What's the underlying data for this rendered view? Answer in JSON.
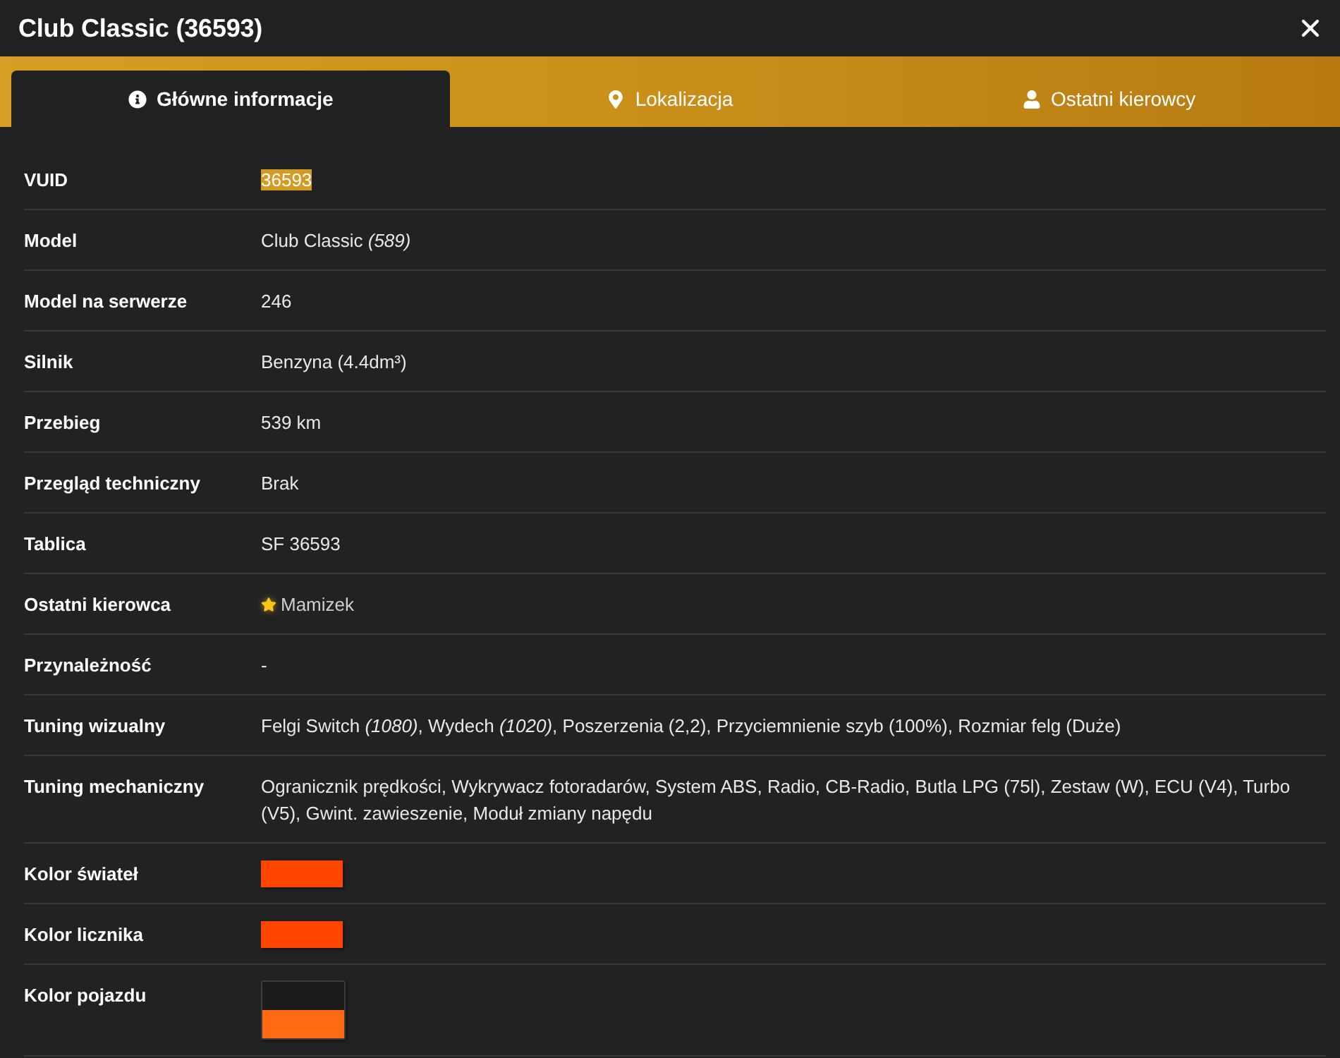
{
  "window": {
    "title": "Club Classic (36593)"
  },
  "tabs": [
    {
      "label": "Główne informacje",
      "selected": true
    },
    {
      "label": "Lokalizacja",
      "selected": false
    },
    {
      "label": "Ostatni kierowcy",
      "selected": false
    }
  ],
  "rows": [
    {
      "label": "VUID",
      "kind": "text",
      "value": "36593",
      "highlighted": true
    },
    {
      "label": "Model",
      "kind": "text",
      "value": "Club Classic *(589)*",
      "highlighted": false
    },
    {
      "label": "Model na serwerze",
      "kind": "text",
      "value": "246",
      "highlighted": false
    },
    {
      "label": "Silnik",
      "kind": "text",
      "value": "Benzyna (4.4dm³)",
      "highlighted": false
    },
    {
      "label": "Przebieg",
      "kind": "text",
      "value": "539 km",
      "highlighted": false
    },
    {
      "label": "Przegląd techniczny",
      "kind": "text",
      "value": "Brak",
      "highlighted": false
    },
    {
      "label": "Tablica",
      "kind": "text",
      "value": "SF 36593",
      "highlighted": false
    },
    {
      "label": "Ostatni kierowca",
      "kind": "driver",
      "value": "Mamizek",
      "starred": true
    },
    {
      "label": "Przynależność",
      "kind": "text",
      "value": "-",
      "highlighted": false
    },
    {
      "label": "Tuning wizualny",
      "kind": "text",
      "value": "Felgi Switch *(1080)*, Wydech *(1020)*, Poszerzenia (2,2), Przyciemnienie szyb (100%), Rozmiar felg (Duże)",
      "highlighted": false
    },
    {
      "label": "Tuning mechaniczny",
      "kind": "text",
      "value": "Ogranicznik prędkości, Wykrywacz fotoradarów, System ABS, Radio, CB-Radio, Butla LPG (75l), Zestaw (W), ECU (V4), Turbo (V5), Gwint. zawieszenie, Moduł zmiany napędu",
      "highlighted": false
    },
    {
      "label": "Kolor świateł",
      "kind": "colors",
      "swatches": [
        {
          "color": "#ff4500"
        }
      ]
    },
    {
      "label": "Kolor licznika",
      "kind": "colors",
      "swatches": [
        {
          "color": "#ff4500"
        }
      ]
    },
    {
      "label": "Kolor pojazdu",
      "kind": "colors",
      "swatches": [
        {
          "color": "#1c1c1c"
        },
        {
          "color": "#ff6a13"
        }
      ]
    }
  ]
}
